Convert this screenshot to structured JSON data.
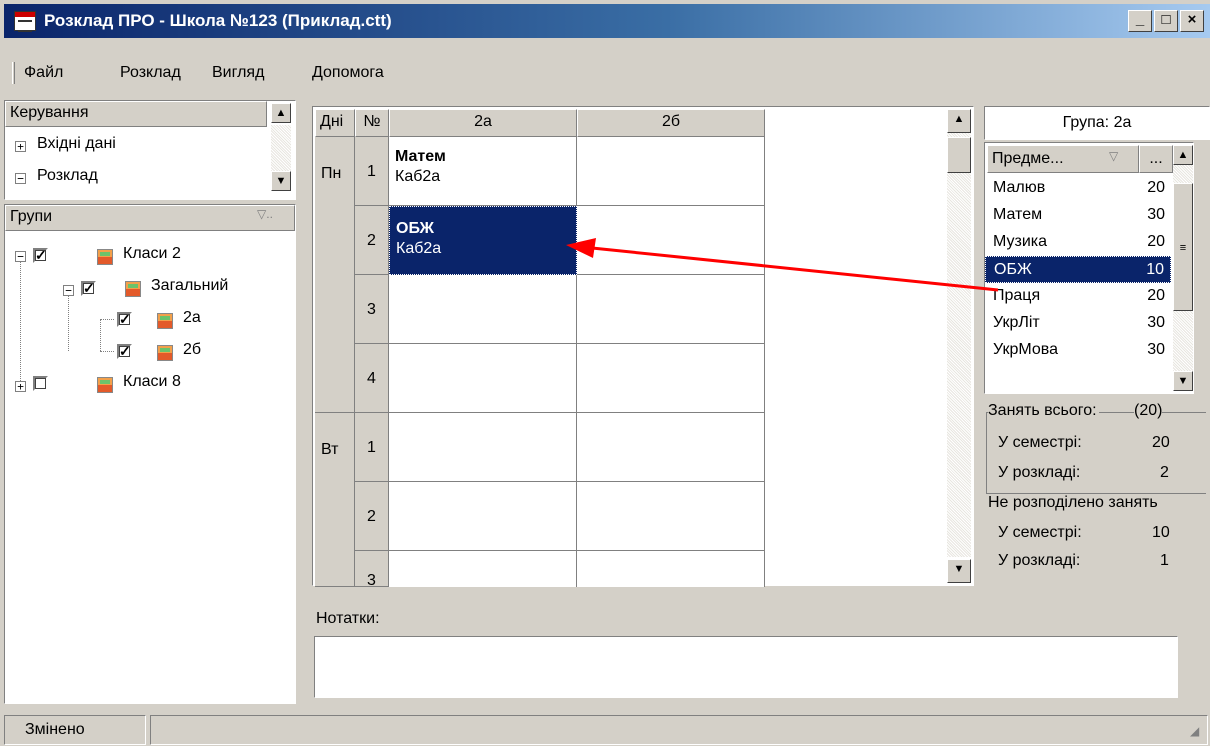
{
  "window": {
    "title": "Розклад ПРО - Школа №123 (Приклад.ctt)",
    "min_label": "_",
    "max_label": "□",
    "close_label": "×"
  },
  "menu": [
    "Файл",
    "Розклад",
    "Вигляд",
    "Допомога"
  ],
  "control": {
    "header": "Керування",
    "items": [
      {
        "expander": "+",
        "label": "Вхідні дані"
      },
      {
        "expander": "−",
        "label": "Розклад"
      }
    ]
  },
  "groups": {
    "header": "Групи",
    "tree": [
      {
        "label": "Класи 2",
        "checked": true
      },
      {
        "label": "Загальний",
        "checked": true
      },
      {
        "label": "2а",
        "checked": true
      },
      {
        "label": "2б",
        "checked": true
      },
      {
        "label": "Класи 8",
        "checked": false
      }
    ]
  },
  "schedule": {
    "headers": {
      "days": "Дні",
      "num": "№",
      "col1": "2а",
      "col2": "2б"
    },
    "days": [
      "Пн",
      "Вт"
    ],
    "periods": [
      "1",
      "2",
      "3",
      "4",
      "1",
      "2",
      "3"
    ],
    "lessons": [
      {
        "subject": "Матем",
        "room": "Каб2а"
      },
      {
        "subject": "ОБЖ",
        "room": "Каб2а"
      }
    ]
  },
  "right_panel": {
    "group_label": "Група: 2а",
    "col_subject": "Предме...",
    "col_more": "...",
    "subjects": [
      {
        "name": "Малюв",
        "count": "20"
      },
      {
        "name": "Матем",
        "count": "30"
      },
      {
        "name": "Музика",
        "count": "20"
      },
      {
        "name": "ОБЖ",
        "count": "10"
      },
      {
        "name": "Праця",
        "count": "20"
      },
      {
        "name": "УкрЛіт",
        "count": "30"
      },
      {
        "name": "УкрМова",
        "count": "30"
      }
    ],
    "stats": {
      "total_title": "Занять всього:",
      "total_value": "(20)",
      "sem_label": "У семестрі:",
      "sem_value": "20",
      "sched_label": "У розкладі:",
      "sched_value": "2",
      "unalloc_title": "Не розподілено занять",
      "sem2_label": "У семестрі:",
      "sem2_value": "10",
      "sched2_label": "У розкладі:",
      "sched2_value": "1"
    }
  },
  "notes": {
    "label": "Нотатки:",
    "value": ""
  },
  "status": {
    "text": "Змінено"
  },
  "colors": {
    "selection": "#0a246a",
    "arrow": "#ff0000"
  }
}
